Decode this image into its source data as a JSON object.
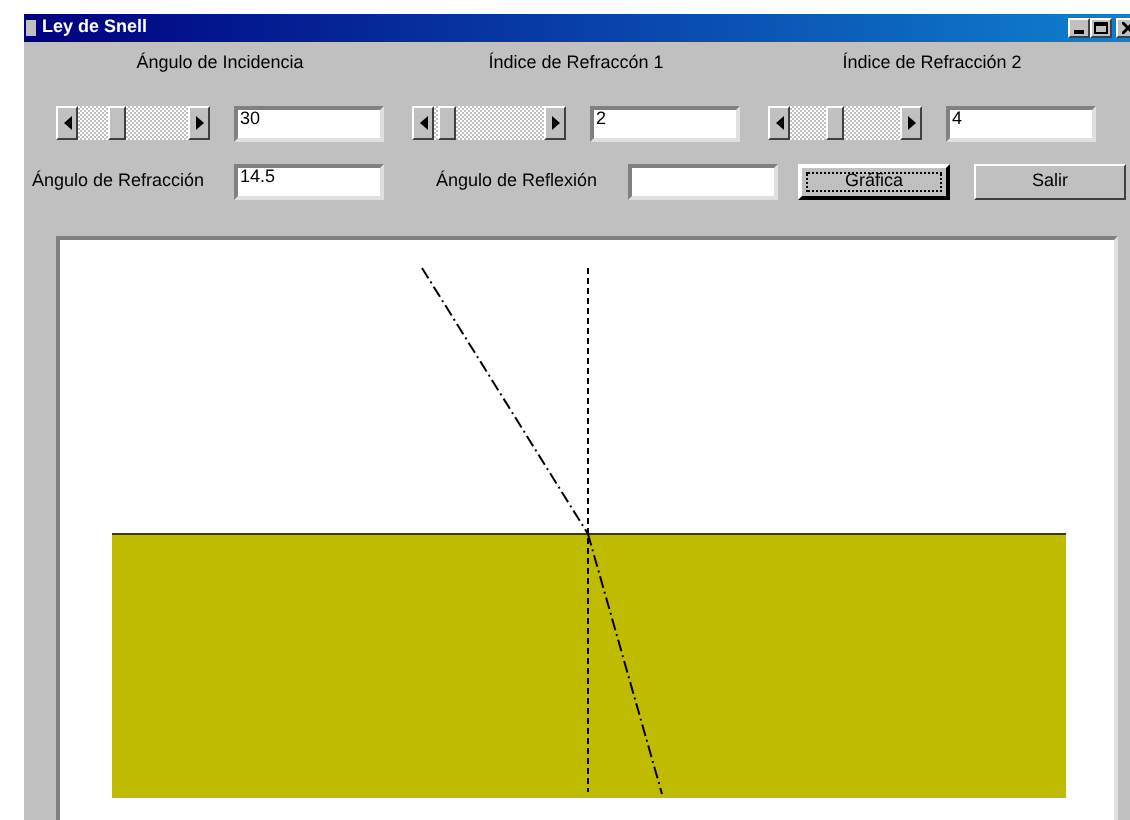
{
  "window": {
    "title": "Ley de Snell"
  },
  "sliders": [
    {
      "label": "Ángulo de Incidencia",
      "level": 0.33,
      "value": "30"
    },
    {
      "label": "Índice de Refraccón 1",
      "level": 0.05,
      "value": "2"
    },
    {
      "label": "Índice de Refracción 2",
      "level": 0.4,
      "value": "4"
    }
  ],
  "outputs": [
    {
      "label": "Ángulo de Refracción",
      "value": "14.5"
    },
    {
      "label": "Ángulo de Reflexión"
    }
  ],
  "buttons": [
    {
      "label": "Gráfica",
      "focused": true
    },
    {
      "label": "Salir",
      "focused": false
    }
  ]
}
